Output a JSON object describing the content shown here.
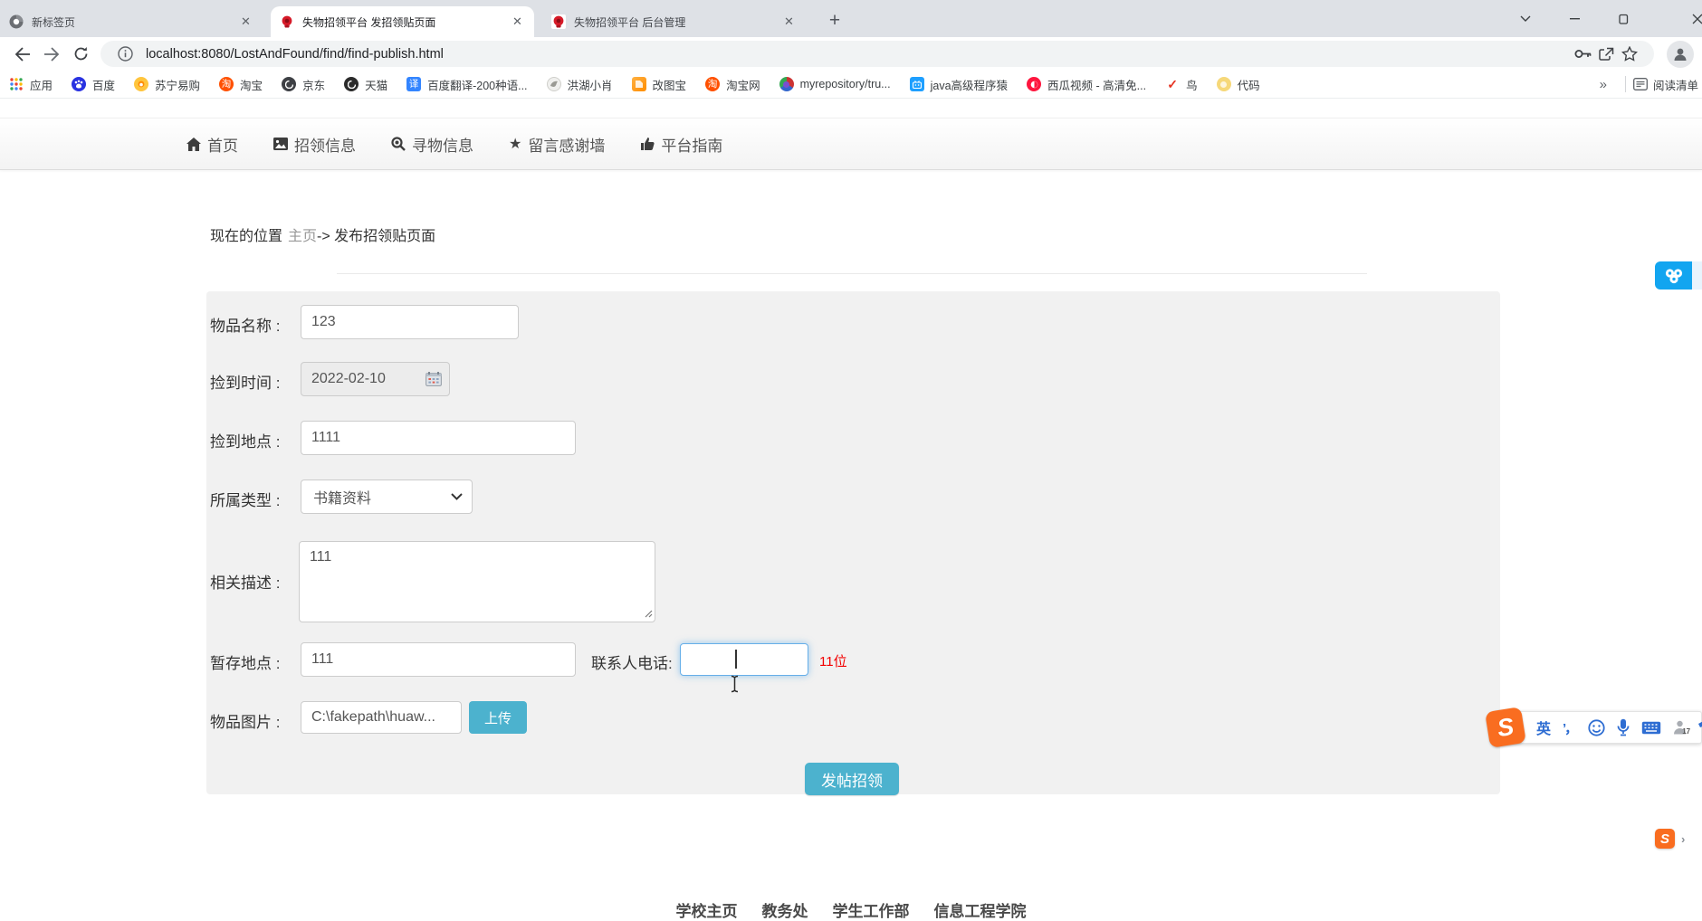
{
  "browser": {
    "tabs": [
      {
        "title": "新标签页"
      },
      {
        "title": "失物招领平台 发招领贴页面"
      },
      {
        "title": "失物招领平台 后台管理"
      }
    ],
    "close_glyph": "✕",
    "new_tab_glyph": "+",
    "url": "localhost:8080/LostAndFound/find/find-publish.html",
    "bookmarks": [
      {
        "label": "应用",
        "glyph": ""
      },
      {
        "label": "百度",
        "glyph": ""
      },
      {
        "label": "苏宁易购",
        "glyph": ""
      },
      {
        "label": "淘宝",
        "glyph": "淘"
      },
      {
        "label": "京东",
        "glyph": ""
      },
      {
        "label": "天猫",
        "glyph": ""
      },
      {
        "label": "百度翻译-200种语...",
        "glyph": "译"
      },
      {
        "label": "洪湖小肖",
        "glyph": ""
      },
      {
        "label": "改图宝",
        "glyph": ""
      },
      {
        "label": "淘宝网",
        "glyph": "淘"
      },
      {
        "label": "myrepository/tru...",
        "glyph": ""
      },
      {
        "label": "java高级程序猿",
        "glyph": ""
      },
      {
        "label": "西瓜视频 - 高清免...",
        "glyph": ""
      },
      {
        "label": "鸟",
        "glyph": "✓"
      },
      {
        "label": "代码",
        "glyph": ""
      }
    ],
    "overflow_glyph": "»",
    "reading_list": "阅读清单"
  },
  "site": {
    "nav": [
      {
        "label": "首页"
      },
      {
        "label": "招领信息"
      },
      {
        "label": "寻物信息"
      },
      {
        "label": "留言感谢墙"
      },
      {
        "label": "平台指南"
      }
    ],
    "nav_star_glyph": "★",
    "breadcrumb": {
      "label": "现在的位置",
      "home": "主页",
      "separator": "->",
      "current": "发布招领贴页面"
    }
  },
  "form": {
    "item_name": {
      "label": "物品名称 :",
      "value": "123"
    },
    "found_time": {
      "label": "捡到时间 :",
      "value": "2022-02-10"
    },
    "found_place": {
      "label": "捡到地点 :",
      "value": "1111"
    },
    "category": {
      "label": "所属类型 :",
      "value": "书籍资料"
    },
    "description": {
      "label": "相关描述 :",
      "value": "111"
    },
    "storage_place": {
      "label": "暂存地点 :",
      "value": "111"
    },
    "phone": {
      "label": "联系人电话:",
      "value": "",
      "hint": "11位"
    },
    "image": {
      "label": "物品图片 :",
      "value": "C:\\fakepath\\huaw...",
      "upload_label": "上传"
    },
    "submit_label": "发帖招领"
  },
  "footer": {
    "links": [
      {
        "label": "学校主页"
      },
      {
        "label": "教务处"
      },
      {
        "label": "学生工作部"
      },
      {
        "label": "信息工程学院"
      }
    ]
  },
  "ime": {
    "mode": "英",
    "punct": "’，",
    "person_badge": "17",
    "mini_s": "S",
    "mini_expand": "›"
  }
}
